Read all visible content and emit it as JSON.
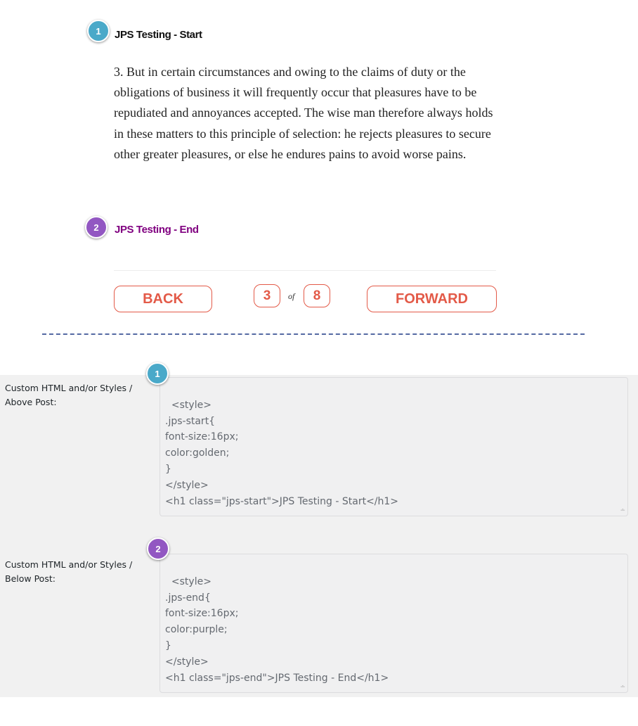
{
  "preview": {
    "start_heading": "JPS Testing - Start",
    "paragraph": "3. But in certain circumstances and owing to the claims of duty or the obligations of business it will frequently occur that pleasures have to be repudiated and annoyances accepted. The wise man therefore always holds in these matters to this principle of selection: he rejects pleasures to secure other greater pleasures, or else he endures pains to avoid worse pains.",
    "end_heading": "JPS Testing - End",
    "start_heading_color": "#111111",
    "end_heading_color": "#800080"
  },
  "pagination": {
    "back_label": "BACK",
    "forward_label": "FORWARD",
    "current_page": "3",
    "of_label": "of",
    "total_pages": "8",
    "accent_color": "#e35a48"
  },
  "badges": {
    "one": "1",
    "two": "2",
    "one_color": "#4aa9c9",
    "two_color": "#9257c2"
  },
  "settings": {
    "above_label": "Custom HTML and/or Styles / Above Post:",
    "above_code": "<style>\n.jps-start{\nfont-size:16px;\ncolor:golden;\n}\n</style>\n<h1 class=\"jps-start\">JPS Testing - Start</h1>",
    "below_label": "Custom HTML and/or Styles / Below Post:",
    "below_code": "<style>\n.jps-end{\nfont-size:16px;\ncolor:purple;\n}\n</style>\n<h1 class=\"jps-end\">JPS Testing - End</h1>"
  }
}
